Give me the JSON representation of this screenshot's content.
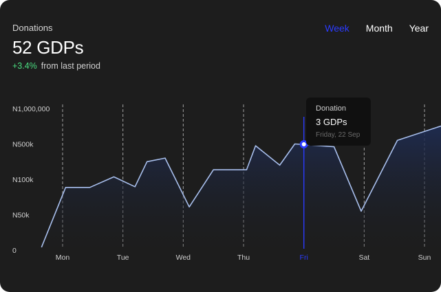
{
  "header": {
    "label": "Donations",
    "value": "52 GDPs",
    "change_pct": "+3.4%",
    "change_text": "from last period"
  },
  "tabs": [
    {
      "label": "Week",
      "active": true
    },
    {
      "label": "Month",
      "active": false
    },
    {
      "label": "Year",
      "active": false
    }
  ],
  "tooltip": {
    "title": "Donation",
    "value": "3 GDPs",
    "date": "Friday, 22 Sep"
  },
  "colors": {
    "background": "#1d1d1d",
    "line": "#a9c0ee",
    "accent": "#2b3bff",
    "positive": "#4ade80"
  },
  "chart_data": {
    "type": "area",
    "x_ticks": [
      "Mon",
      "Tue",
      "Wed",
      "Thu",
      "Fri",
      "Sat",
      "Sun"
    ],
    "y_ticks": [
      "0",
      "N50k",
      "N100k",
      "N500k",
      "N1,000,000"
    ],
    "highlighted_tick": "Fri",
    "points": [
      {
        "x": -0.35,
        "y": 0.08
      },
      {
        "x": 0.05,
        "y": 1.77
      },
      {
        "x": 0.45,
        "y": 1.77
      },
      {
        "x": 0.85,
        "y": 2.07
      },
      {
        "x": 1.2,
        "y": 1.79
      },
      {
        "x": 1.4,
        "y": 2.5
      },
      {
        "x": 1.7,
        "y": 2.6
      },
      {
        "x": 2.1,
        "y": 1.22
      },
      {
        "x": 2.5,
        "y": 2.27
      },
      {
        "x": 3.05,
        "y": 2.27
      },
      {
        "x": 3.2,
        "y": 2.95
      },
      {
        "x": 3.6,
        "y": 2.4
      },
      {
        "x": 3.85,
        "y": 3.0
      },
      {
        "x": 4.5,
        "y": 2.92
      },
      {
        "x": 4.95,
        "y": 1.1
      },
      {
        "x": 5.55,
        "y": 3.1
      },
      {
        "x": 6.35,
        "y": 3.55
      }
    ],
    "highlight_point": {
      "x": 4.0,
      "y": 2.99
    },
    "grid": "vertical-dashed"
  }
}
